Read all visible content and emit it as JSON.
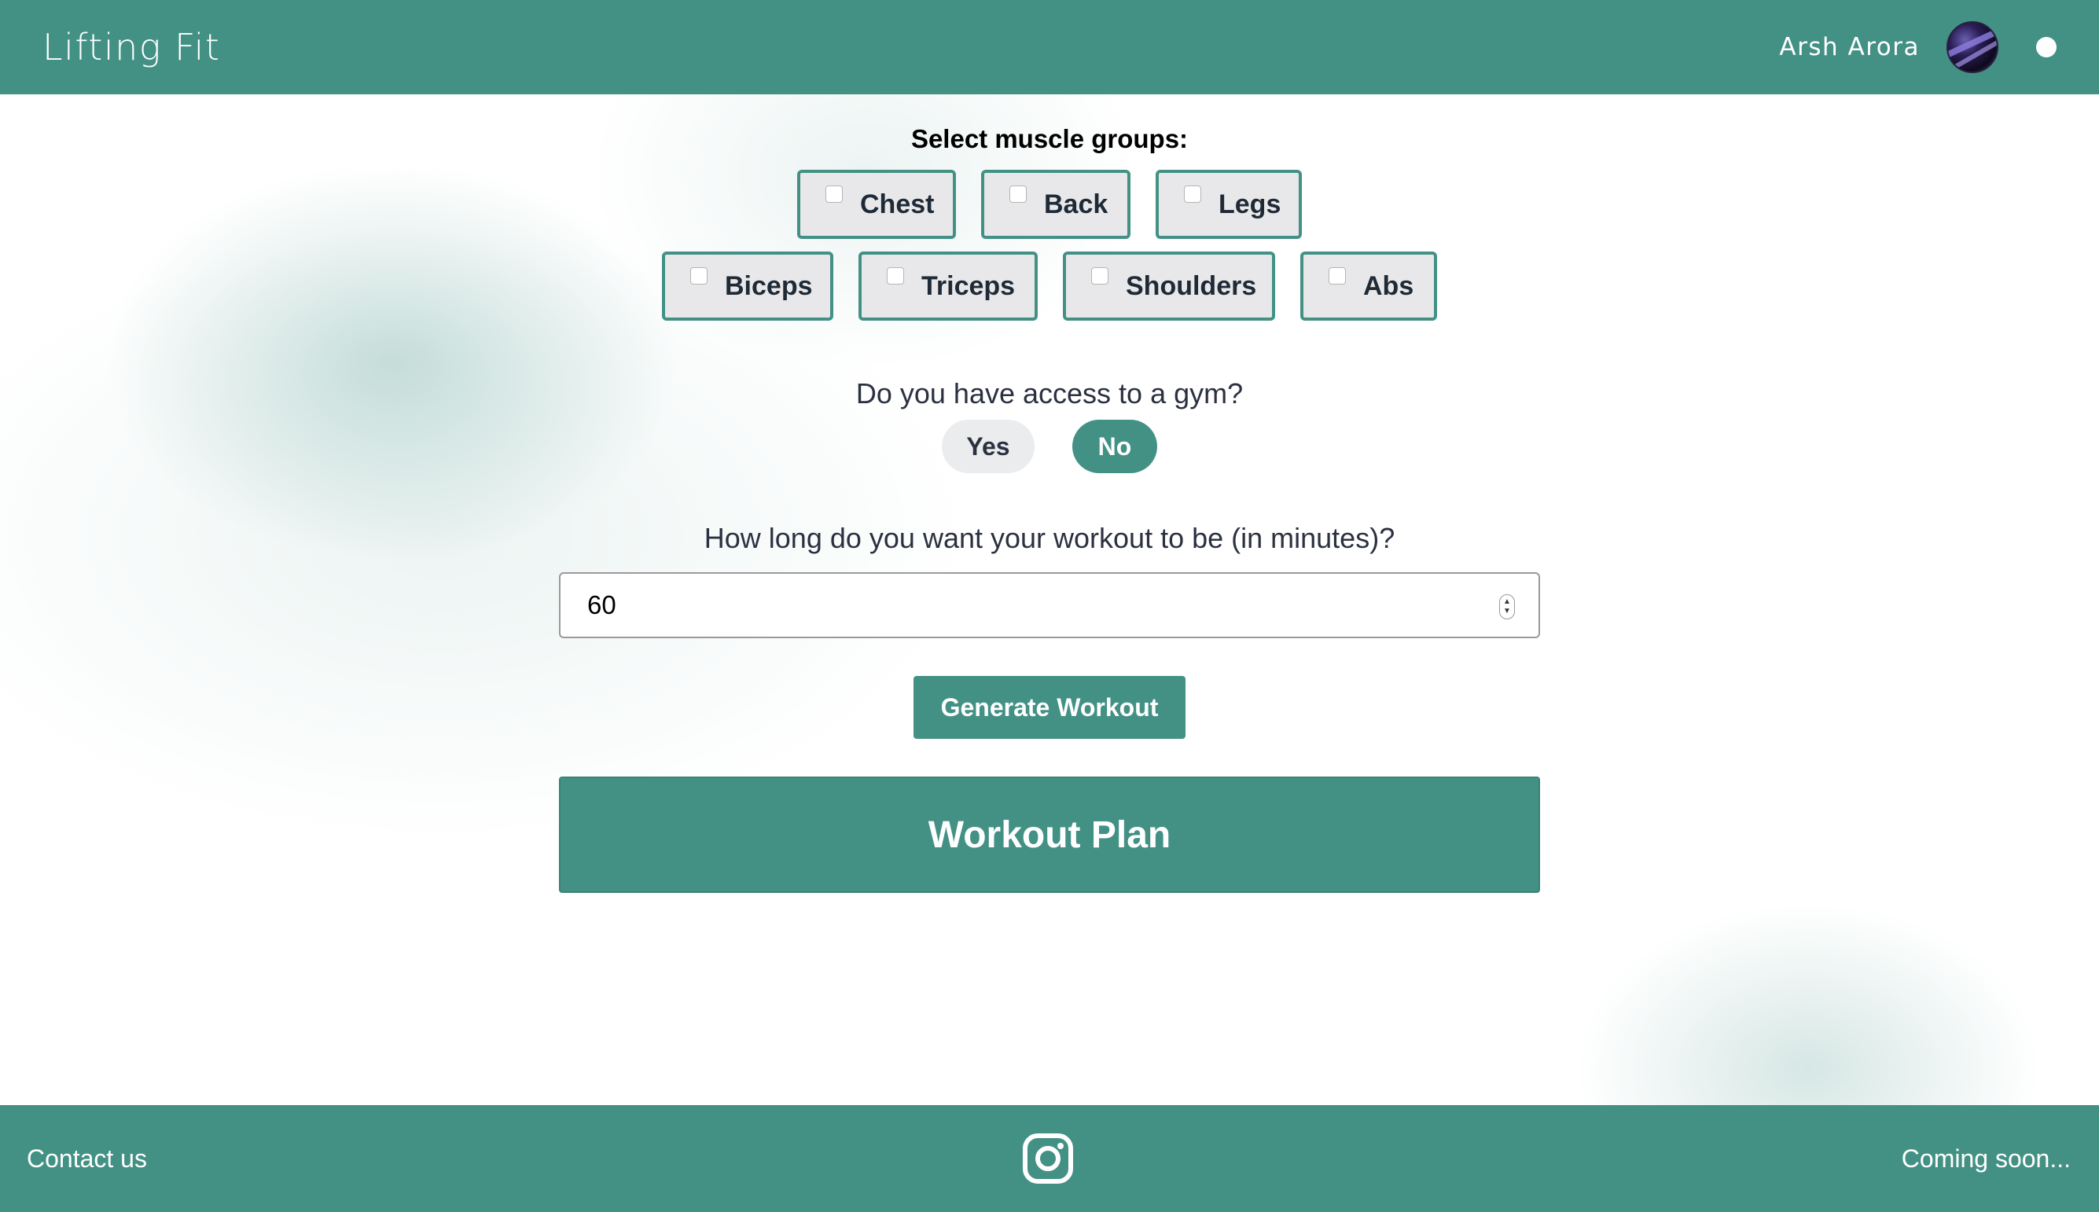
{
  "header": {
    "brand": "Lifting Fit",
    "username": "Arsh Arora"
  },
  "muscle_groups": {
    "label": "Select muscle groups:",
    "row1": [
      {
        "label": "Chest",
        "checked": false
      },
      {
        "label": "Back",
        "checked": false
      },
      {
        "label": "Legs",
        "checked": false
      }
    ],
    "row2": [
      {
        "label": "Biceps",
        "checked": false
      },
      {
        "label": "Triceps",
        "checked": false
      },
      {
        "label": "Shoulders",
        "checked": false
      },
      {
        "label": "Abs",
        "checked": false
      }
    ]
  },
  "gym": {
    "question": "Do you have access to a gym?",
    "yes_label": "Yes",
    "no_label": "No",
    "selected": "No"
  },
  "duration": {
    "question": "How long do you want your workout to be (in minutes)?",
    "value": "60"
  },
  "generate_label": "Generate Workout",
  "plan_title": "Workout Plan",
  "footer": {
    "contact_label": "Contact us",
    "coming_soon": "Coming soon..."
  },
  "colors": {
    "accent": "#439185",
    "button_bg": "#e8e8ea",
    "text_dark": "#2b3140"
  },
  "icons": {
    "avatar": "profile-avatar",
    "theme_toggle": "theme-dot-icon",
    "social": "instagram-icon"
  }
}
